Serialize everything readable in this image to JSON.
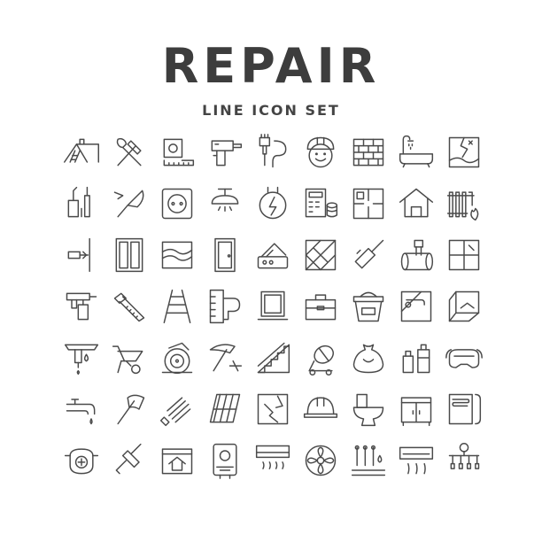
{
  "header": {
    "title": "REPAIR",
    "subtitle": "LINE ICON SET"
  },
  "icons": [
    "roof-ladder-icon",
    "hammer-wrench-icon",
    "tape-measure-icon",
    "drill-icon",
    "paint-brush-icon",
    "worker-helmet-icon",
    "brick-wall-icon",
    "bathtub-shower-icon",
    "cracked-wall-icon",
    "sealant-gun-icon",
    "trowel-icon",
    "power-socket-icon",
    "ceiling-lamp-icon",
    "electric-meter-icon",
    "calculator-coins-icon",
    "floor-plan-icon",
    "house-icon",
    "radiator-fire-icon",
    "dowel-wall-icon",
    "door-frame-icon",
    "landscape-painting-icon",
    "door-icon",
    "color-palette-icon",
    "parquet-floor-icon",
    "squeegee-icon",
    "pipe-icon",
    "tiles-icon",
    "spray-gun-icon",
    "hand-saw-icon",
    "ladder-icon",
    "level-bubble-icon",
    "window-icon",
    "toolbox-icon",
    "paint-bucket-icon",
    "wallpaper-roll-icon",
    "room-corner-icon",
    "gutter-icon",
    "wheelbarrow-icon",
    "circular-saw-icon",
    "pickaxe-icon",
    "stairs-icon",
    "cement-mixer-icon",
    "sandbag-icon",
    "spray-cans-icon",
    "safety-goggles-icon",
    "faucet-icon",
    "axe-icon",
    "spiral-bulb-icon",
    "roof-tiles-icon",
    "wall-crack-icon",
    "hard-hat-icon",
    "toilet-icon",
    "cabinet-icon",
    "floor-heating-icon",
    "respirator-mask-icon",
    "paint-roller-icon",
    "house-blueprint-icon",
    "water-heater-icon",
    "air-conditioner-icon",
    "fan-vent-icon",
    "underfloor-pipes-icon",
    "split-ac-icon",
    "water-distribution-icon"
  ]
}
